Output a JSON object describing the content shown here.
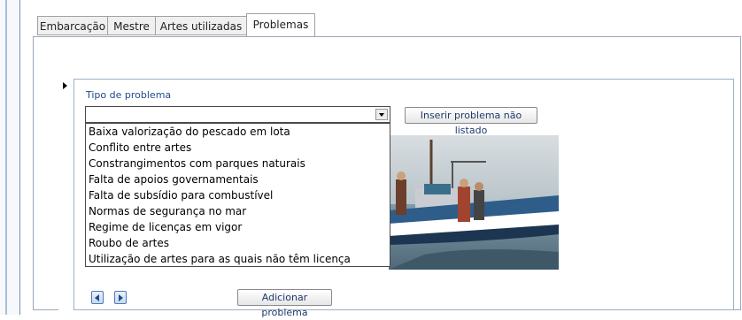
{
  "tabs": [
    {
      "label": "Embarcação",
      "active": false
    },
    {
      "label": "Mestre",
      "active": false
    },
    {
      "label": "Artes utilizadas",
      "active": false
    },
    {
      "label": "Problemas",
      "active": true
    }
  ],
  "subform": {
    "tipo_label": "Tipo de problema",
    "combo_value": "",
    "inserir_button": "Inserir problema não listado",
    "adicionar_button": "Adicionar problema",
    "photo": "fishing-boat-photo"
  },
  "dropdown": {
    "options": [
      "Baixa valorização do pescado em lota",
      "Conflito entre artes",
      "Constrangimentos com parques naturais",
      "Falta de apoios governamentais",
      "Falta de subsídio para combustível",
      "Normas de segurança no mar",
      "Regime de licenças em vigor",
      "Roubo de artes",
      "Utilização de artes para as quais não têm licença"
    ]
  },
  "icons": {
    "record_selector": "record-selector-arrow-icon",
    "prev": "previous-record-icon",
    "next": "next-record-icon"
  }
}
